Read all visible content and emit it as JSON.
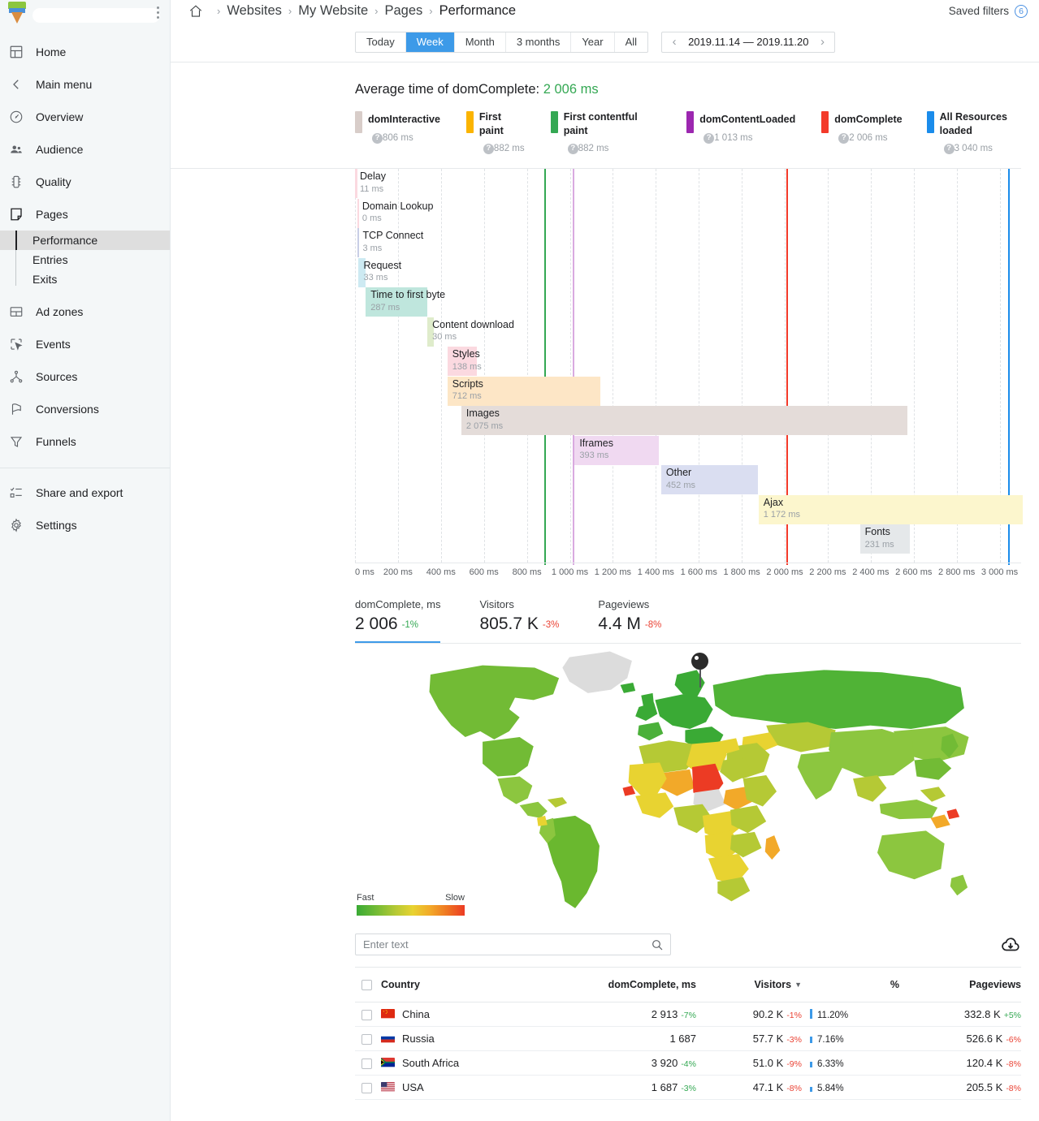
{
  "sidebar": {
    "brand_redacted": true,
    "kebab_name": "more-options",
    "items": [
      {
        "label": "Home",
        "icon": "home-grid-icon"
      },
      {
        "label": "Main menu",
        "icon": "chevron-left-icon"
      },
      {
        "label": "Overview",
        "icon": "gauge-icon"
      },
      {
        "label": "Audience",
        "icon": "people-icon"
      },
      {
        "label": "Quality",
        "icon": "traffic-light-icon"
      },
      {
        "label": "Pages",
        "icon": "page-icon"
      }
    ],
    "subitems": [
      {
        "label": "Performance",
        "active": true
      },
      {
        "label": "Entries",
        "active": false
      },
      {
        "label": "Exits",
        "active": false
      }
    ],
    "items2": [
      {
        "label": "Ad zones",
        "icon": "ad-zones-icon"
      },
      {
        "label": "Events",
        "icon": "cursor-click-icon"
      },
      {
        "label": "Sources",
        "icon": "branch-icon"
      },
      {
        "label": "Conversions",
        "icon": "flag-icon"
      },
      {
        "label": "Funnels",
        "icon": "funnel-icon"
      }
    ],
    "items3": [
      {
        "label": "Share and export",
        "icon": "share-export-icon"
      },
      {
        "label": "Settings",
        "icon": "gear-icon"
      }
    ]
  },
  "header": {
    "home_icon": "home-icon",
    "breadcrumbs": [
      "Websites",
      "My Website",
      "Pages",
      "Performance"
    ],
    "separator": "›",
    "saved_filters_label": "Saved filters",
    "saved_filters_count": "6"
  },
  "periodbar": {
    "tabs": [
      {
        "label": "Today",
        "active": false
      },
      {
        "label": "Week",
        "active": true
      },
      {
        "label": "Month",
        "active": false
      },
      {
        "label": "3 months",
        "active": false
      },
      {
        "label": "Year",
        "active": false
      },
      {
        "label": "All",
        "active": false
      }
    ],
    "prev_icon": "chevron-left-icon",
    "next_icon": "chevron-right-icon",
    "date_range": "2019.11.14 — 2019.11.20"
  },
  "summary": {
    "title_prefix": "Average time of domComplete:",
    "title_value": "2 006 ms",
    "value_color": "#34a853"
  },
  "legend": [
    {
      "name": "domInteractive",
      "value": "806 ms",
      "color": "#d8cdc9",
      "help": "?"
    },
    {
      "name": "First paint",
      "value": "882 ms",
      "color": "#fbb400",
      "help": "?"
    },
    {
      "name": "First contentful paint",
      "value": "882 ms",
      "color": "#34a853",
      "help": "?"
    },
    {
      "name": "domContentLoaded",
      "value": "1 013 ms",
      "color": "#9c27b0",
      "help": "?"
    },
    {
      "name": "domComplete",
      "value": "2 006 ms",
      "color": "#f33a2a",
      "help": "?"
    },
    {
      "name": "All Resources loaded",
      "value": "3 040 ms",
      "color": "#1a8ceb",
      "help": "?"
    }
  ],
  "chart_data": {
    "type": "bar",
    "title": "Page load waterfall",
    "xlabel": "",
    "ylabel": "",
    "xlim": [
      0,
      3100
    ],
    "x_ticks": [
      "0 ms",
      "200 ms",
      "400 ms",
      "600 ms",
      "800 ms",
      "1 000 ms",
      "1 200 ms",
      "1 400 ms",
      "1 600 ms",
      "1 800 ms",
      "2 000 ms",
      "2 200 ms",
      "2 400 ms",
      "2 600 ms",
      "2 800 ms",
      "3 000 ms"
    ],
    "x_tick_values": [
      0,
      200,
      400,
      600,
      800,
      1000,
      1200,
      1400,
      1600,
      1800,
      2000,
      2200,
      2400,
      2600,
      2800,
      3000
    ],
    "grid": true,
    "legend_position": "top",
    "categories": [
      "Delay",
      "Domain Lookup",
      "TCP Connect",
      "Request",
      "Time to first byte",
      "Content download",
      "Styles",
      "Scripts",
      "Images",
      "Iframes",
      "Other",
      "Ajax",
      "Fonts"
    ],
    "bars": [
      {
        "label": "Delay",
        "value_text": "11 ms",
        "start": 0,
        "duration": 11,
        "color": "#fbd9e0"
      },
      {
        "label": "Domain Lookup",
        "value_text": "0 ms",
        "start": 11,
        "duration": 2,
        "color": "#fbd9e0"
      },
      {
        "label": "TCP Connect",
        "value_text": "3 ms",
        "start": 13,
        "duration": 4,
        "color": "#c9cfe6"
      },
      {
        "label": "Request",
        "value_text": "33 ms",
        "start": 17,
        "duration": 33,
        "color": "#cdeaf2"
      },
      {
        "label": "Time to first byte",
        "value_text": "287 ms",
        "start": 50,
        "duration": 287,
        "color": "#bfe6dd"
      },
      {
        "label": "Content download",
        "value_text": "30 ms",
        "start": 337,
        "duration": 30,
        "color": "#dfeccb"
      },
      {
        "label": "Styles",
        "value_text": "138 ms",
        "start": 430,
        "duration": 138,
        "color": "#fbd9e0"
      },
      {
        "label": "Scripts",
        "value_text": "712 ms",
        "start": 430,
        "duration": 712,
        "color": "#fde6c6"
      },
      {
        "label": "Images",
        "value_text": "2 075 ms",
        "start": 495,
        "duration": 2075,
        "color": "#e4dcd9"
      },
      {
        "label": "Iframes",
        "value_text": "393 ms",
        "start": 1022,
        "duration": 393,
        "color": "#f0d9f1"
      },
      {
        "label": "Other",
        "value_text": "452 ms",
        "start": 1425,
        "duration": 452,
        "color": "#dadef1"
      },
      {
        "label": "Ajax",
        "value_text": "1 172 ms",
        "start": 1878,
        "duration": 1230,
        "color": "#fcf6cd"
      },
      {
        "label": "Fonts",
        "value_text": "231 ms",
        "start": 2350,
        "duration": 231,
        "color": "#e5e8ea"
      }
    ],
    "markers": [
      {
        "name": "First contentful paint",
        "value": 882,
        "color": "#34a853"
      },
      {
        "name": "domContentLoaded",
        "value": 1013,
        "color": "#d9aae0"
      },
      {
        "name": "domComplete",
        "value": 2006,
        "color": "#f33a2a"
      },
      {
        "name": "All Resources loaded",
        "value": 3040,
        "color": "#1a8ceb"
      }
    ]
  },
  "kpis": [
    {
      "label": "domComplete, ms",
      "value": "2 006",
      "delta": "-1%",
      "delta_dir": "up",
      "active": true
    },
    {
      "label": "Visitors",
      "value": "805.7 K",
      "delta": "-3%",
      "delta_dir": "down",
      "active": false
    },
    {
      "label": "Pageviews",
      "value": "4.4 M",
      "delta": "-8%",
      "delta_dir": "down",
      "active": false
    }
  ],
  "map": {
    "legend_fast": "Fast",
    "legend_slow": "Slow",
    "pin_name": "map-marker-pin"
  },
  "search": {
    "placeholder": "Enter text",
    "value": "",
    "icon": "search-icon",
    "export_icon": "cloud-download-icon"
  },
  "table": {
    "columns": [
      {
        "label": "Country",
        "align": "left"
      },
      {
        "label": "domComplete, ms",
        "align": "right"
      },
      {
        "label": "Visitors",
        "align": "right",
        "sorted": true,
        "sort_icon": "▼"
      },
      {
        "label": "%",
        "align": "right"
      },
      {
        "label": "Pageviews",
        "align": "right"
      }
    ],
    "rows": [
      {
        "country": "China",
        "flag": "cn",
        "domcomplete": "2 913",
        "domcomplete_delta": "-7%",
        "domcomplete_dir": "up",
        "visitors": "90.2 K",
        "visitors_delta": "-1%",
        "visitors_dir": "down",
        "percent": "11.20%",
        "bar_pct": 100,
        "pageviews": "332.8 K",
        "pageviews_delta": "+5%",
        "pageviews_dir": "up"
      },
      {
        "country": "Russia",
        "flag": "ru",
        "domcomplete": "1 687",
        "domcomplete_delta": "",
        "domcomplete_dir": "",
        "visitors": "57.7 K",
        "visitors_delta": "-3%",
        "visitors_dir": "down",
        "percent": "7.16%",
        "bar_pct": 64,
        "pageviews": "526.6 K",
        "pageviews_delta": "-6%",
        "pageviews_dir": "down"
      },
      {
        "country": "South Africa",
        "flag": "za",
        "domcomplete": "3 920",
        "domcomplete_delta": "-4%",
        "domcomplete_dir": "up",
        "visitors": "51.0 K",
        "visitors_delta": "-9%",
        "visitors_dir": "down",
        "percent": "6.33%",
        "bar_pct": 57,
        "pageviews": "120.4 K",
        "pageviews_delta": "-8%",
        "pageviews_dir": "down"
      },
      {
        "country": "USA",
        "flag": "us",
        "domcomplete": "1 687",
        "domcomplete_delta": "-3%",
        "domcomplete_dir": "up",
        "visitors": "47.1 K",
        "visitors_delta": "-8%",
        "visitors_dir": "down",
        "percent": "5.84%",
        "bar_pct": 52,
        "pageviews": "205.5 K",
        "pageviews_delta": "-8%",
        "pageviews_dir": "down"
      }
    ]
  }
}
